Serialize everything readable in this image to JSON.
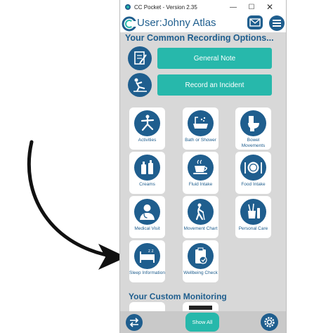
{
  "window": {
    "title": "CC Pocket - Version 2.35",
    "controls": [
      "minimize-icon",
      "maximize-icon",
      "close-icon"
    ]
  },
  "header": {
    "user_prefix": "User:",
    "user_name": "Johny Atlas",
    "mail_icon": "mail-icon",
    "menu_icon": "hamburger-menu-icon"
  },
  "common_section": {
    "title": "Your Common Recording Options...",
    "buttons": [
      {
        "label": "General Note",
        "icon": "note-pencil-icon"
      },
      {
        "label": "Record an Incident",
        "icon": "fall-incident-icon"
      }
    ]
  },
  "tiles": [
    {
      "label": "Activities",
      "icon": "yoga-pose-icon"
    },
    {
      "label": "Bath or Shower",
      "icon": "bathtub-icon"
    },
    {
      "label": "Bowel Movements",
      "icon": "toilet-icon"
    },
    {
      "label": "Creams",
      "icon": "cream-bottles-icon"
    },
    {
      "label": "Fluid Intake",
      "icon": "teacup-icon"
    },
    {
      "label": "Food Intake",
      "icon": "plate-cutlery-icon"
    },
    {
      "label": "Medical Visit",
      "icon": "doctor-icon"
    },
    {
      "label": "Movement Chart",
      "icon": "walking-cane-icon"
    },
    {
      "label": "Personal Care",
      "icon": "toothbrush-cup-icon"
    },
    {
      "label": "Sleep Information",
      "icon": "bed-zzz-icon"
    },
    {
      "label": "Wellbeing Check",
      "icon": "clipboard-check-icon"
    }
  ],
  "custom_section": {
    "title": "Your Custom Monitoring"
  },
  "footer": {
    "show_all_label": "Show All",
    "back_icon": "swap-arrows-icon",
    "settings_icon": "gear-icon"
  },
  "colors": {
    "primary": "#1f5e8e",
    "accent": "#27b8ab",
    "background": "#d8d8d8"
  }
}
